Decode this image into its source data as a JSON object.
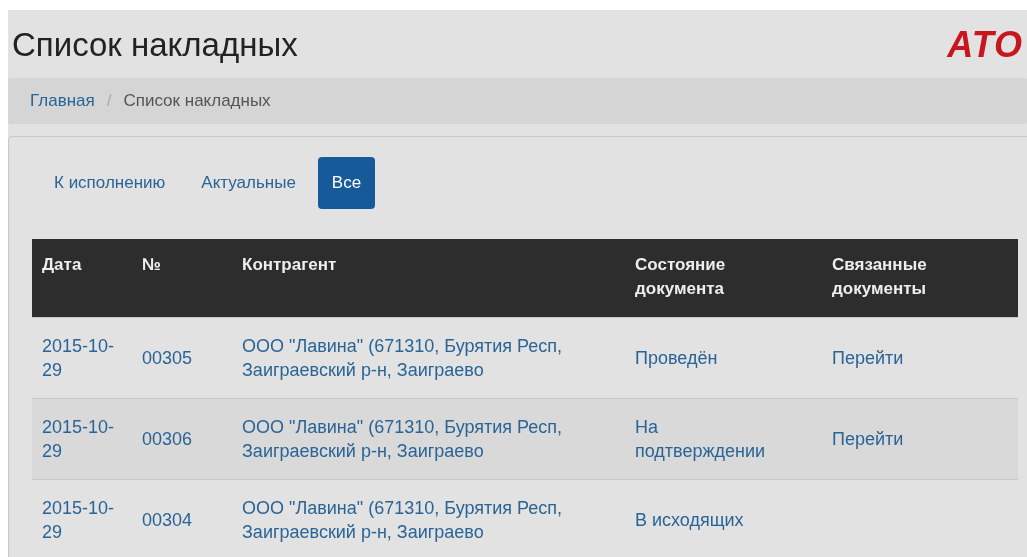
{
  "header": {
    "title": "Список накладных",
    "logo": "ATO"
  },
  "breadcrumb_separator": "/",
  "breadcrumb": [
    {
      "label": "Главная",
      "kind": "link"
    },
    {
      "label": "Список накладных",
      "kind": "current"
    }
  ],
  "tabs": [
    {
      "label": "К исполнению",
      "selected": false
    },
    {
      "label": "Актуальные",
      "selected": false
    },
    {
      "label": "Все",
      "selected": true
    }
  ],
  "table": {
    "columns": [
      "Дата",
      "№",
      "Контрагент",
      "Состояние документа",
      "Связанные документы"
    ],
    "rows": [
      {
        "date": "2015-10-29",
        "number": "00305",
        "contractor": "ООО \"Лавина\" (671310, Бурятия Респ, Заиграевский р-н, Заиграево",
        "status": "Проведён",
        "related": "Перейти"
      },
      {
        "date": "2015-10-29",
        "number": "00306",
        "contractor": "ООО \"Лавина\" (671310, Бурятия Респ, Заиграевский р-н, Заиграево",
        "status": "На подтверждении",
        "related": "Перейти"
      },
      {
        "date": "2015-10-29",
        "number": "00304",
        "contractor": "ООО \"Лавина\" (671310, Бурятия Респ, Заиграевский р-н, Заиграево",
        "status": "В исходящих"
      }
    ]
  }
}
